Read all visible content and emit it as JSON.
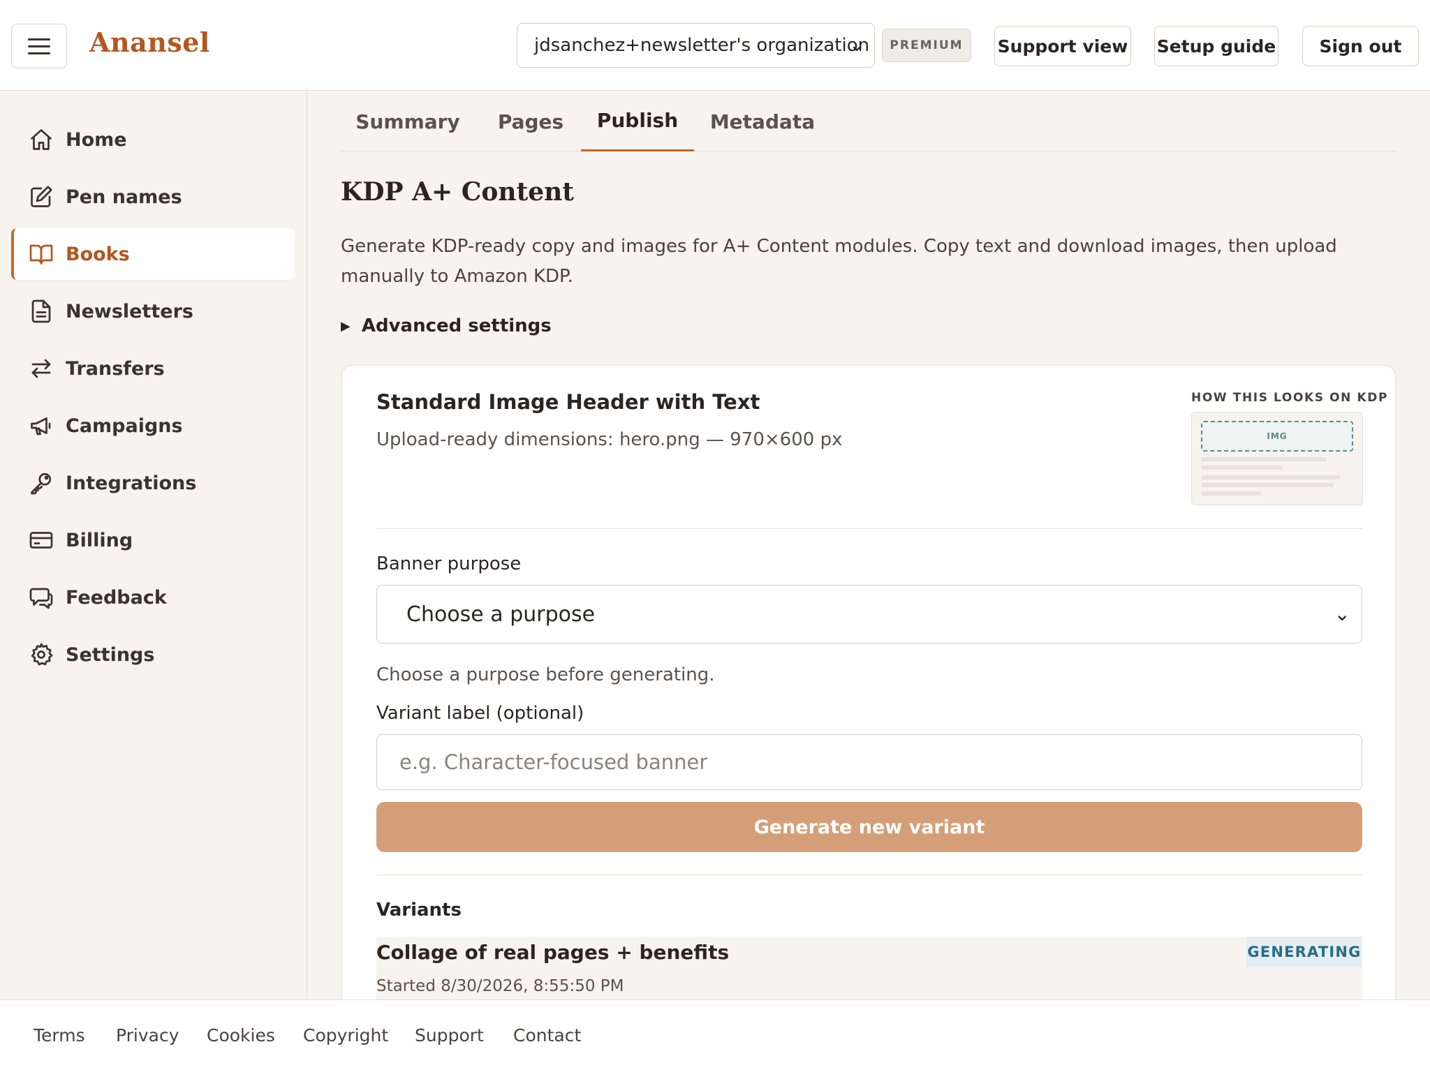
{
  "header": {
    "brand": "Anansel",
    "org_select": "jdsanchez+newsletter's organization",
    "plan_badge": "PREMIUM",
    "buttons": {
      "support": "Support view",
      "setup": "Setup guide",
      "signout": "Sign out"
    }
  },
  "sidebar": {
    "items": [
      {
        "label": "Home",
        "icon": "home-icon"
      },
      {
        "label": "Pen names",
        "icon": "pencil-icon"
      },
      {
        "label": "Books",
        "icon": "book-icon",
        "active": true
      },
      {
        "label": "Newsletters",
        "icon": "document-icon"
      },
      {
        "label": "Transfers",
        "icon": "transfer-icon"
      },
      {
        "label": "Campaigns",
        "icon": "megaphone-icon"
      },
      {
        "label": "Integrations",
        "icon": "key-icon"
      },
      {
        "label": "Billing",
        "icon": "card-icon"
      },
      {
        "label": "Feedback",
        "icon": "chat-icon"
      },
      {
        "label": "Settings",
        "icon": "gear-icon"
      }
    ]
  },
  "tabs": [
    {
      "label": "Summary"
    },
    {
      "label": "Pages"
    },
    {
      "label": "Publish",
      "active": true
    },
    {
      "label": "Metadata"
    }
  ],
  "main": {
    "title": "KDP A+ Content",
    "description": "Generate KDP-ready copy and images for A+ Content modules. Copy text and download images, then upload manually to Amazon KDP.",
    "advanced_settings": "Advanced settings"
  },
  "module": {
    "title": "Standard Image Header with Text",
    "dimensions": "Upload-ready dimensions: hero.png — 970×600 px",
    "preview_label": "HOW THIS LOOKS ON KDP",
    "preview_img": "IMG",
    "purpose_label": "Banner purpose",
    "purpose_value": "Choose a purpose",
    "purpose_hint": "Choose a purpose before generating.",
    "variant_label": "Variant label (optional)",
    "variant_placeholder": "e.g. Character-focused banner",
    "generate_button": "Generate new variant",
    "variants_heading": "Variants",
    "variants": [
      {
        "title": "Collage of real pages + benefits",
        "started": "Started 8/30/2026, 8:55:50 PM",
        "status": "GENERATING"
      }
    ]
  },
  "footer": {
    "links": [
      "Terms",
      "Privacy",
      "Cookies",
      "Copyright",
      "Support",
      "Contact"
    ]
  },
  "colors": {
    "brand": "#b5561f",
    "accent_button": "#d49f78",
    "status_generating": "#2a6b86",
    "background": "#f7f4ef"
  }
}
